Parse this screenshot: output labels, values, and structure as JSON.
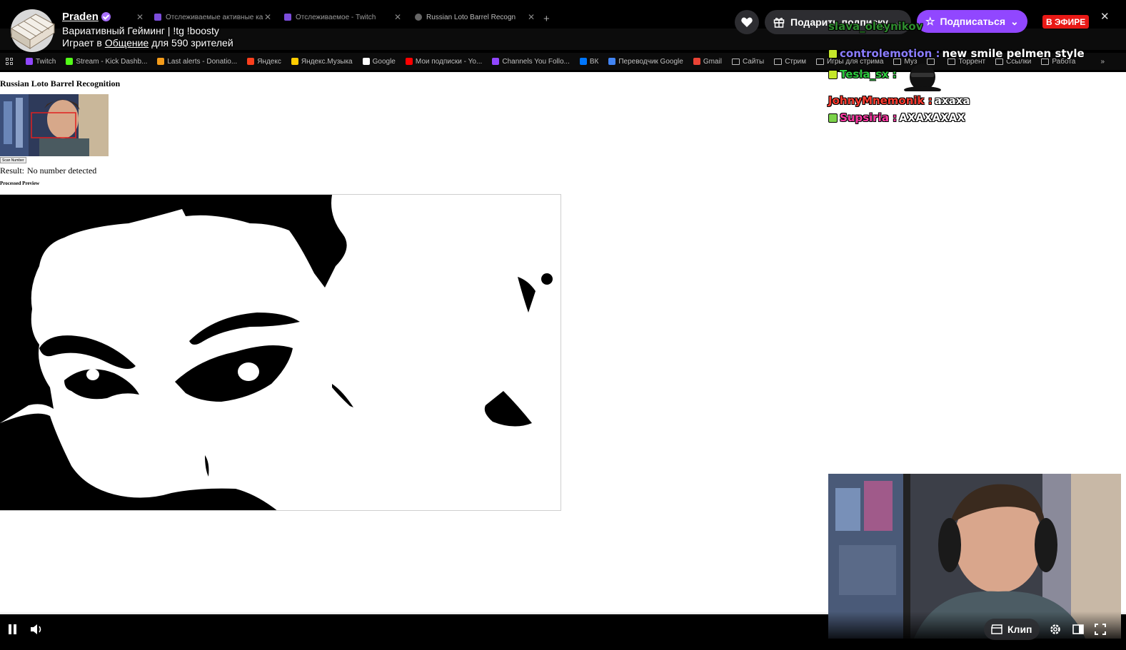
{
  "browser": {
    "tabs": [
      {
        "label": "",
        "active": false
      },
      {
        "label": "Отслеживаемые активные ка",
        "active": false
      },
      {
        "label": "Отслеживаемое - Twitch",
        "active": false
      },
      {
        "label": "Russian Loto Barrel Recogn",
        "active": true
      }
    ],
    "new_tab": "+",
    "bookmarks": [
      {
        "label": "Twitch",
        "icon": "twitch-icon",
        "color": "#9147ff"
      },
      {
        "label": "Stream - Kick Dashb...",
        "icon": "kick-icon",
        "color": "#53fc18"
      },
      {
        "label": "Last alerts - Donatio...",
        "icon": "donation-icon",
        "color": "#f59c1a"
      },
      {
        "label": "Яндекс",
        "icon": "yandex-icon",
        "color": "#fc3f1d"
      },
      {
        "label": "Яндекс.Музыка",
        "icon": "yandex-music-icon",
        "color": "#ffcc00"
      },
      {
        "label": "Google",
        "icon": "google-icon",
        "color": "#ffffff"
      },
      {
        "label": "Мои подписки - Yo...",
        "icon": "youtube-icon",
        "color": "#ff0000"
      },
      {
        "label": "Channels You Follo...",
        "icon": "twitch-icon",
        "color": "#9147ff"
      },
      {
        "label": "ВК",
        "icon": "vk-icon",
        "color": "#0077ff"
      },
      {
        "label": "Переводчик Google",
        "icon": "translate-icon",
        "color": "#4285f4"
      },
      {
        "label": "Gmail",
        "icon": "gmail-icon",
        "color": "#ea4335"
      },
      {
        "label": "Сайты",
        "icon": "folder-icon",
        "color": ""
      },
      {
        "label": "Стрим",
        "icon": "folder-icon",
        "color": ""
      },
      {
        "label": "Игры для стрима",
        "icon": "folder-icon",
        "color": ""
      },
      {
        "label": "Муз",
        "icon": "folder-icon",
        "color": ""
      },
      {
        "label": "",
        "icon": "folder-icon",
        "color": ""
      },
      {
        "label": "Торрент",
        "icon": "folder-icon",
        "color": ""
      },
      {
        "label": "Ссылки",
        "icon": "folder-icon",
        "color": ""
      },
      {
        "label": "Работа",
        "icon": "folder-icon",
        "color": ""
      }
    ],
    "more_bookmarks": "»"
  },
  "page": {
    "heading": "Russian Loto Barrel Recognition",
    "scan_button": "Scan Number",
    "result_label": "Result:",
    "result_value": "No number detected",
    "processed_label": "Processed Preview"
  },
  "stream": {
    "streamer": "Praden",
    "title": "Вариативный Гейминг | !tg !boosty",
    "playing_prefix": "Играет в",
    "category": "Общение",
    "viewers_text": "для 590 зрителей",
    "gift_label": "Подарить подписку",
    "subscribe_label": "Подписаться",
    "live_label": "В ЭФИРЕ",
    "clip_label": "Клип"
  },
  "chat": [
    {
      "user": "slava_oleynikov",
      "message": "",
      "color": "#2e8b2e",
      "badge": ""
    },
    {
      "user": "controlemotion :",
      "message": "new smile pelmen style",
      "color": "#8a7cff",
      "badge": "#c5e82a"
    },
    {
      "user": "Tesla_sx :",
      "message": "",
      "color": "#2ecc40",
      "badge": "#c5e82a"
    },
    {
      "user": "JohnyMnemonik :",
      "message": "ахаха",
      "color": "#ff3b30",
      "badge": ""
    },
    {
      "user": "Supsiria :",
      "message": "АХАХАХАХ",
      "color": "#ff3ca6",
      "badge": "#7cd34a"
    }
  ],
  "colors": {
    "twitch_purple": "#9147ff",
    "live_red": "#e91916",
    "page_bg": "#ffffff"
  }
}
